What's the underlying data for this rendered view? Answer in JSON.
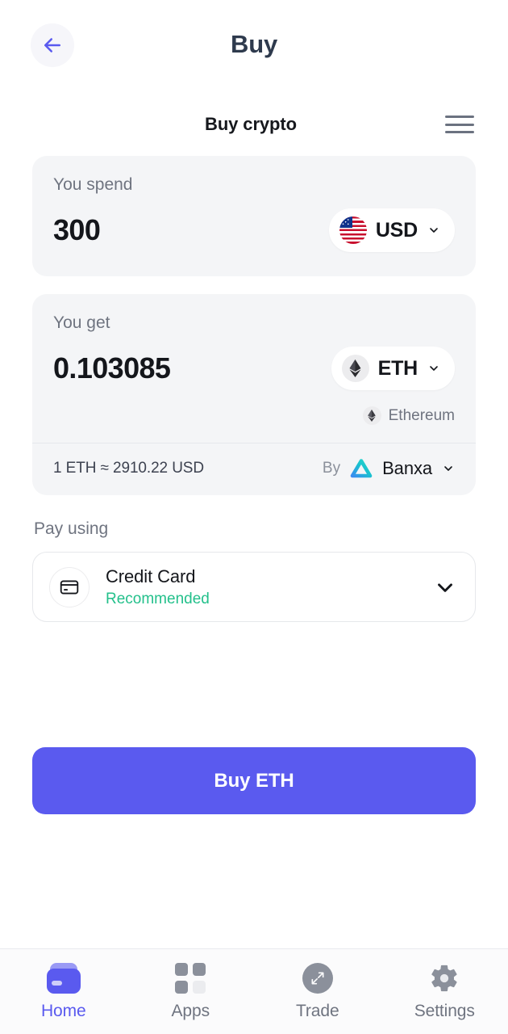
{
  "topbar": {
    "title": "Buy",
    "back_icon": "arrow-left-icon",
    "back_color": "#5a5aef"
  },
  "section": {
    "title": "Buy crypto",
    "menu_icon": "hamburger-menu-icon"
  },
  "spend": {
    "label": "You spend",
    "amount": "300",
    "placeholder": "0",
    "currency_code": "USD",
    "currency_icon": "us-flag-icon",
    "chevron_icon": "chevron-down-icon"
  },
  "get": {
    "label": "You get",
    "amount": "0.103085",
    "placeholder": "0",
    "asset_code": "ETH",
    "asset_icon": "ethereum-icon",
    "asset_name": "Ethereum",
    "chevron_icon": "chevron-down-icon"
  },
  "rate": {
    "text": "1 ETH ≈ 2910.22 USD",
    "by_label": "By",
    "provider_name": "Banxa",
    "provider_icon": "banxa-triangle-icon",
    "provider_color_top": "#2bd9c9",
    "provider_color_bottom": "#3a8df0",
    "chevron_icon": "chevron-down-icon"
  },
  "pay": {
    "label": "Pay using",
    "method_name": "Credit Card",
    "method_note": "Recommended",
    "method_note_color": "#23c08b",
    "method_icon": "credit-card-icon",
    "chevron_icon": "chevron-down-icon"
  },
  "cta": {
    "label": "Buy ETH",
    "color": "#5a5aef"
  },
  "bottom_nav": {
    "items": [
      {
        "label": "Home",
        "icon": "wallet-icon",
        "active": true
      },
      {
        "label": "Apps",
        "icon": "grid-icon",
        "active": false
      },
      {
        "label": "Trade",
        "icon": "expand-arrows-icon",
        "active": false
      },
      {
        "label": "Settings",
        "icon": "gear-icon",
        "active": false
      }
    ]
  }
}
